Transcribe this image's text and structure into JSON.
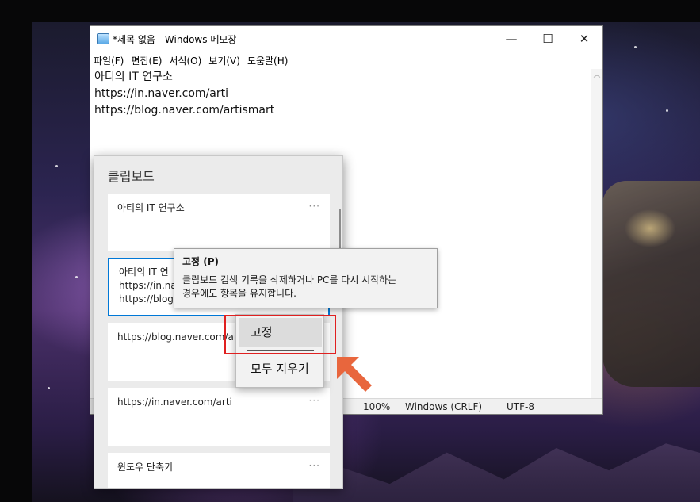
{
  "notepad": {
    "title": "*제목 없음 - Windows 메모장",
    "window_buttons": {
      "minimize": "—",
      "maximize": "☐",
      "close": "✕"
    },
    "menu": [
      "파일(F)",
      "편집(E)",
      "서식(O)",
      "보기(V)",
      "도움말(H)"
    ],
    "lines": [
      "아티의 IT 연구소",
      "https://in.naver.com/arti",
      "https://blog.naver.com/artismart"
    ],
    "status": {
      "zoom": "100%",
      "line_ending": "Windows (CRLF)",
      "encoding": "UTF-8"
    }
  },
  "clipboard": {
    "title": "클립보드",
    "more_glyph": "···",
    "items": [
      {
        "text": "아티의 IT 연구소"
      },
      {
        "lines": [
          "아티의 IT 연",
          "https://in.na",
          "https://blog."
        ]
      },
      {
        "text": "https://blog.naver.com/art"
      },
      {
        "text": "https://in.naver.com/arti"
      },
      {
        "text": "윈도우 단축키"
      }
    ]
  },
  "tooltip": {
    "title": "고정 (P)",
    "line1": "클립보드 검색 기록을 삭제하거나 PC를 다시 시작하는",
    "line2": "경우에도 항목을 유지합니다."
  },
  "context_menu": {
    "pin": "고정",
    "clear_all": "모두 지우기"
  },
  "colors": {
    "accent": "#0078d7",
    "highlight": "#e02020",
    "arrow": "#e8663d"
  },
  "icons": {
    "notepad": "notepad-icon",
    "more": "ellipsis-icon",
    "pointer": "arrow-icon"
  }
}
